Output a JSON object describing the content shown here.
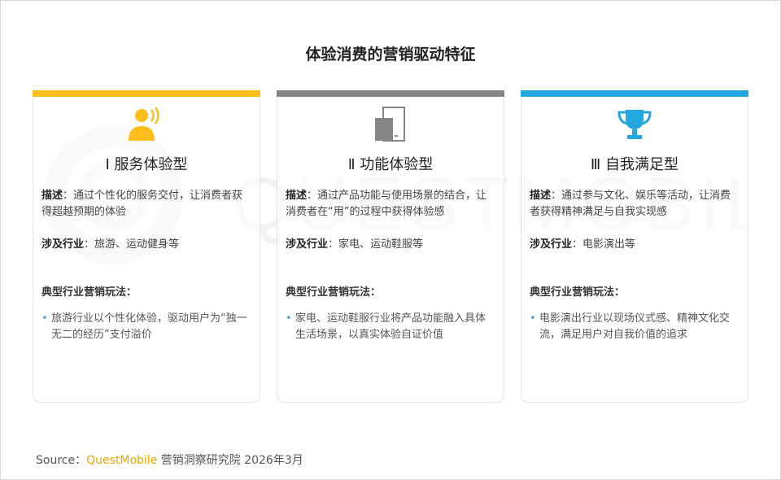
{
  "page_title": "体验消费的营销驱动特征",
  "watermark_text": "QUESTMOBILE",
  "colors": {
    "yellow": "#ffbe1a",
    "gray": "#858585",
    "blue": "#22a7df"
  },
  "cards": [
    {
      "title": "Ⅰ 服务体验型",
      "icon": "person-speaking-icon",
      "desc_label": "描述",
      "desc_text": "：通过个性化的服务交付，让消费者获得超越预期的体验",
      "industry_label": "涉及行业",
      "industry_text": "：旅游、运动健身等",
      "play_label": "典型行业营销玩法：",
      "bullet": "旅游行业以个性化体验，驱动用户为“独一无二的经历”支付溢价"
    },
    {
      "title": "Ⅱ 功能体验型",
      "icon": "device-icon",
      "desc_label": "描述",
      "desc_text": "：通过产品功能与使用场景的结合，让消费者在“用”的过程中获得体验感",
      "industry_label": "涉及行业",
      "industry_text": "：家电、运动鞋服等",
      "play_label": "典型行业营销玩法：",
      "bullet": "家电、运动鞋服行业将产品功能融入具体生活场景，以真实体验自证价值"
    },
    {
      "title": "Ⅲ 自我满足型",
      "icon": "trophy-icon",
      "desc_label": "描述",
      "desc_text": "：通过参与文化、娱乐等活动，让消费者获得精神满足与自我实现感",
      "industry_label": "涉及行业",
      "industry_text": "：电影演出等",
      "play_label": "典型行业营销玩法：",
      "bullet": "电影演出行业以现场仪式感、精神文化交流，满足用户对自我价值的追求"
    }
  ],
  "source": {
    "label": "Source：",
    "brand": "QuestMobile",
    "rest": " 营销洞察研究院 2026年3月"
  }
}
